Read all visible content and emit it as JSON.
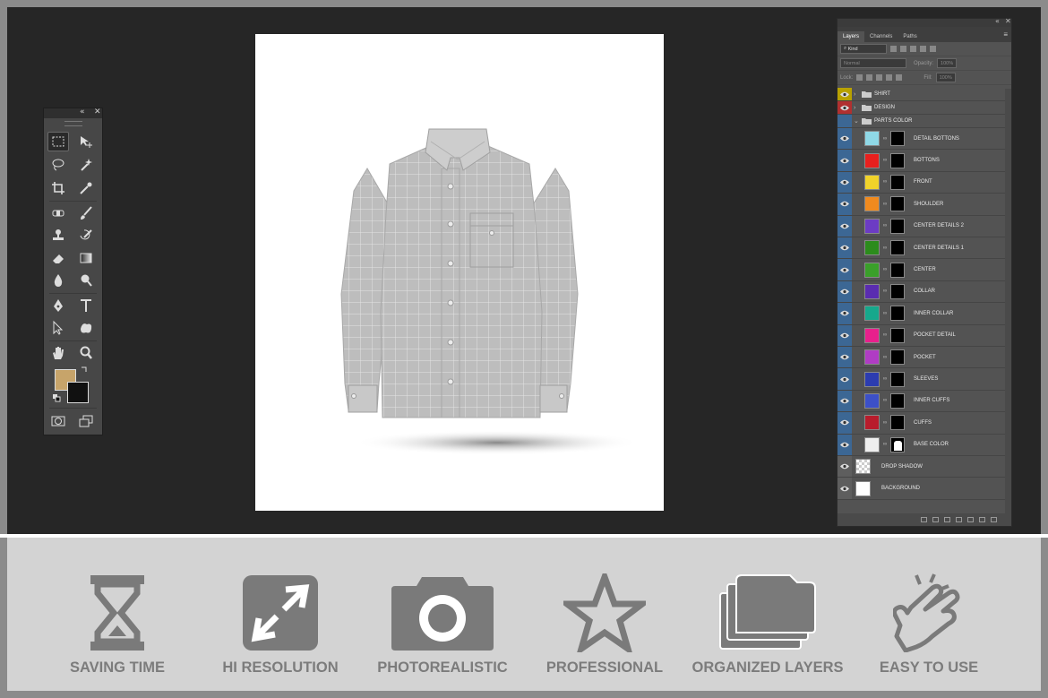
{
  "colors": {
    "workspace_bg": "#262626",
    "panel_bg": "#535353",
    "feature_bar_bg": "#d3d3d3",
    "feature_icon": "#7a7a7a",
    "feature_label": "#7c7c7c",
    "foreground_color": "#c7a46a",
    "background_color": "#111111",
    "eye_column_blue": "#3c6794"
  },
  "toolbox": {
    "collapse_glyph": "«",
    "close_glyph": "✕",
    "tools": [
      {
        "name": "rectangular-marquee-tool",
        "selected": true
      },
      {
        "name": "move-tool"
      },
      {
        "name": "lasso-tool"
      },
      {
        "name": "magic-wand-tool"
      },
      {
        "name": "crop-tool"
      },
      {
        "name": "eyedropper-tool"
      },
      {
        "name": "spot-healing-tool"
      },
      {
        "name": "brush-tool"
      },
      {
        "name": "clone-stamp-tool"
      },
      {
        "name": "history-brush-tool"
      },
      {
        "name": "eraser-tool"
      },
      {
        "name": "gradient-tool"
      },
      {
        "name": "blur-tool"
      },
      {
        "name": "dodge-tool"
      },
      {
        "name": "pen-tool"
      },
      {
        "name": "type-tool"
      },
      {
        "name": "path-selection-tool"
      },
      {
        "name": "custom-shape-tool"
      },
      {
        "name": "hand-tool"
      },
      {
        "name": "zoom-tool"
      }
    ]
  },
  "layers_panel": {
    "tabs": [
      "Layers",
      "Channels",
      "Paths"
    ],
    "active_tab": "Layers",
    "filter_kind": "Kind",
    "blend_mode": "Normal",
    "opacity_label": "Opacity:",
    "opacity_value": "100%",
    "lock_label": "Lock:",
    "fill_label": "Fill:",
    "fill_value": "100%",
    "groups": [
      {
        "name": "SHIRT",
        "eye_color": "#b8a100"
      },
      {
        "name": "DESIGN",
        "eye_color": "#b03030"
      },
      {
        "name": "PARTS COLOR",
        "eye_color": "#3c6794"
      }
    ],
    "layers": [
      {
        "name": "DETAIL BOTTONS",
        "color": "#8fd8e6"
      },
      {
        "name": "BOTTONS",
        "color": "#e8201e"
      },
      {
        "name": "FRONT",
        "color": "#f0d22a"
      },
      {
        "name": "SHOULDER",
        "color": "#f08a1e"
      },
      {
        "name": "CENTER DETAILS 2",
        "color": "#6c3cc4"
      },
      {
        "name": "CENTER DETAILS 1",
        "color": "#2c8c1c"
      },
      {
        "name": "CENTER",
        "color": "#3aa02a"
      },
      {
        "name": "COLLAR",
        "color": "#5a2cb0"
      },
      {
        "name": "INNER COLLAR",
        "color": "#16a88c"
      },
      {
        "name": "POCKET DETAIL",
        "color": "#e8208c"
      },
      {
        "name": "POCKET",
        "color": "#b03cc4"
      },
      {
        "name": "SLEEVES",
        "color": "#2c3cb0"
      },
      {
        "name": "INNER CUFFS",
        "color": "#3c50c8"
      },
      {
        "name": "CUFFS",
        "color": "#b81c2c"
      },
      {
        "name": "BASE COLOR",
        "color": "#eeeeee"
      }
    ],
    "bottom_layers": [
      {
        "name": "DROP SHADOW"
      },
      {
        "name": "BACKGROUND"
      }
    ]
  },
  "features": [
    {
      "label": "SAVING TIME",
      "icon": "hourglass-icon"
    },
    {
      "label": "HI RESOLUTION",
      "icon": "expand-arrows-icon"
    },
    {
      "label": "PHOTOREALISTIC",
      "icon": "camera-icon"
    },
    {
      "label": "PROFESSIONAL",
      "icon": "star-icon"
    },
    {
      "label": "ORGANIZED LAYERS",
      "icon": "stacked-folders-icon"
    },
    {
      "label": "EASY TO USE",
      "icon": "tap-hand-icon"
    }
  ]
}
